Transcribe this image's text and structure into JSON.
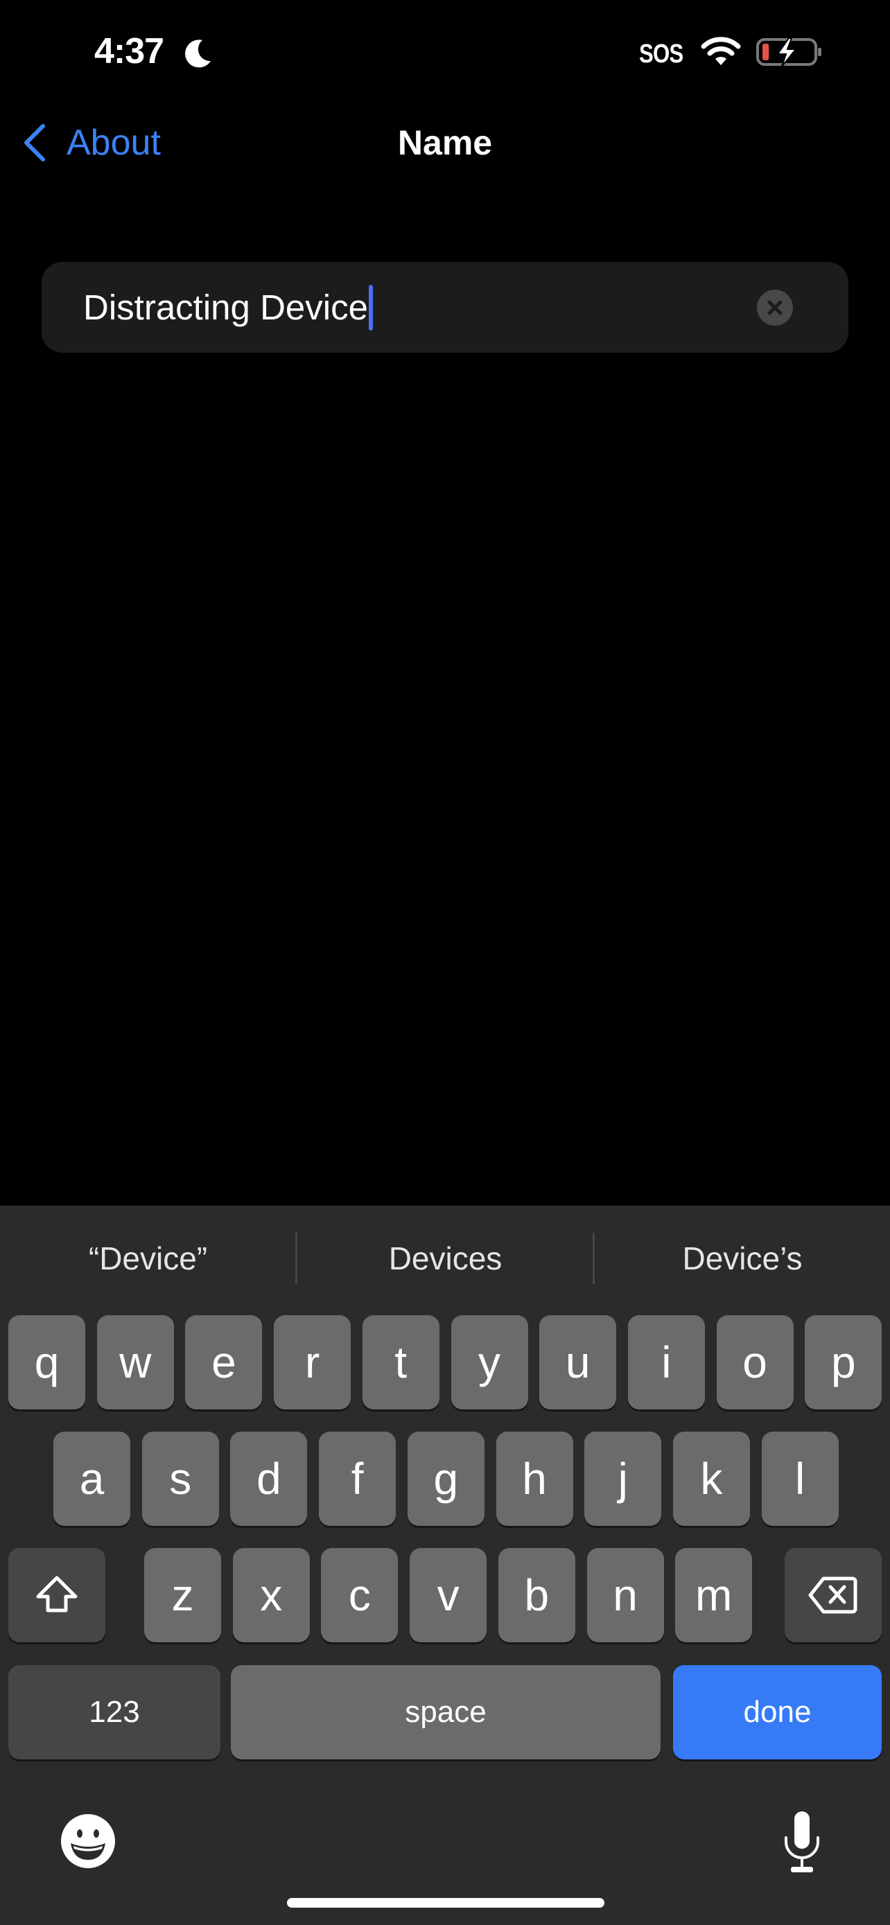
{
  "status_bar": {
    "time": "4:37",
    "focus_icon": "moon-icon",
    "carrier": "SOS",
    "wifi_icon": "wifi-icon",
    "battery_icon": "battery-charging-icon",
    "battery_level_percent": 10,
    "battery_low_color": "#e5534b"
  },
  "nav": {
    "back_label": "About",
    "back_icon": "chevron-left-icon",
    "title": "Name",
    "accent_color": "#3b82f6"
  },
  "name_field": {
    "value": "Distracting Device",
    "clear_icon": "clear-circle-icon",
    "caret_color": "#4f6ef5"
  },
  "keyboard": {
    "suggestions": [
      "“Device”",
      "Devices",
      "Device’s"
    ],
    "rows": [
      [
        "q",
        "w",
        "e",
        "r",
        "t",
        "y",
        "u",
        "i",
        "o",
        "p"
      ],
      [
        "a",
        "s",
        "d",
        "f",
        "g",
        "h",
        "j",
        "k",
        "l"
      ],
      [
        "z",
        "x",
        "c",
        "v",
        "b",
        "n",
        "m"
      ]
    ],
    "shift_icon": "shift-icon",
    "backspace_icon": "backspace-icon",
    "numbers_label": "123",
    "space_label": "space",
    "return_label": "done",
    "return_color": "#367bf5",
    "emoji_icon": "emoji-icon",
    "dictation_icon": "microphone-icon"
  }
}
